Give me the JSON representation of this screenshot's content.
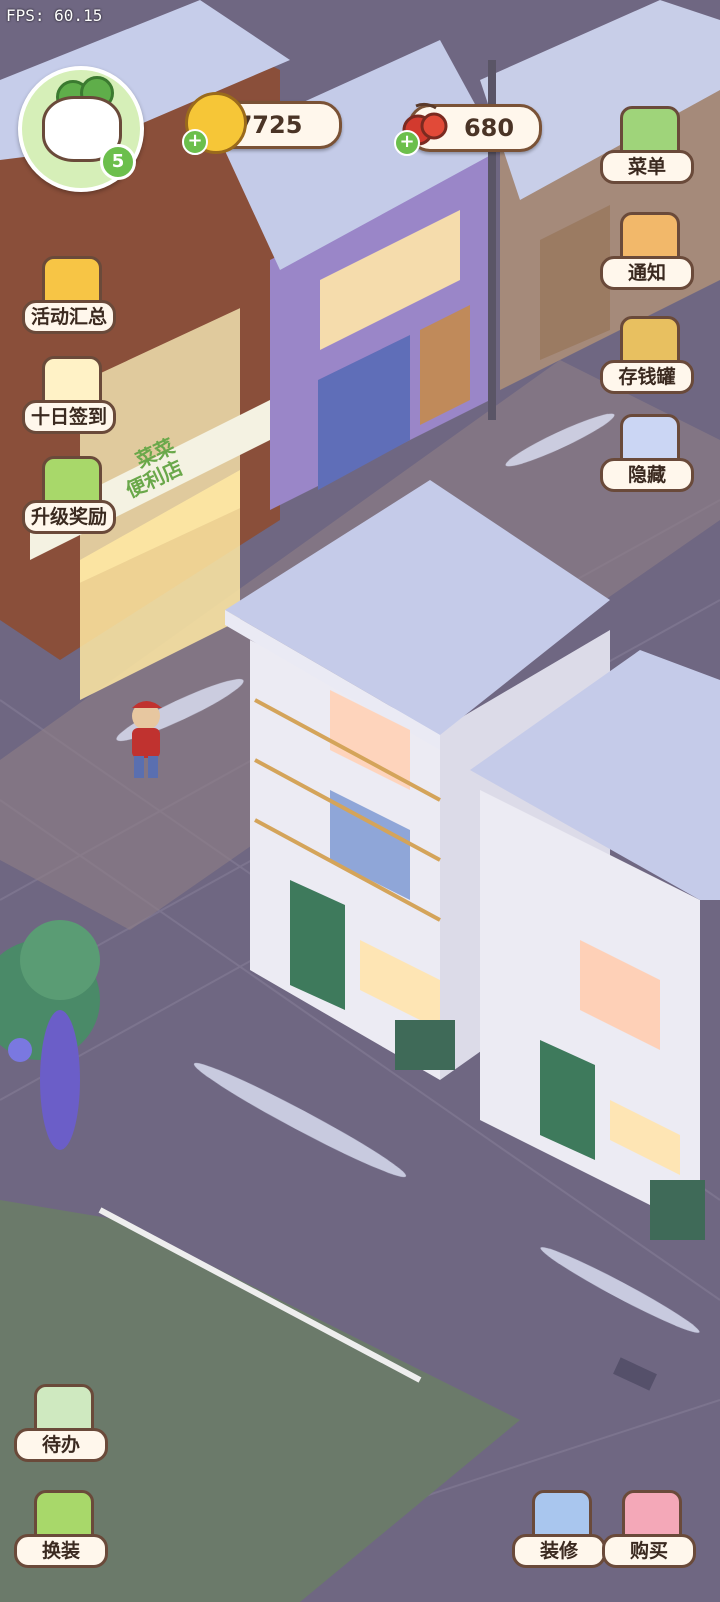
{
  "hud": {
    "fps": "FPS: 60.15",
    "player_level": "5",
    "coins": "7725",
    "cherries": "680",
    "plus_symbol": "+"
  },
  "left_menu": [
    {
      "label": "活动汇总",
      "icon": "crown-icon"
    },
    {
      "label": "十日签到",
      "icon": "calendar-check-icon"
    },
    {
      "label": "升级奖励",
      "icon": "upgrade-arrows-icon"
    }
  ],
  "right_menu": [
    {
      "label": "菜单",
      "icon": "list-menu-icon"
    },
    {
      "label": "通知",
      "icon": "bell-icon"
    },
    {
      "label": "存钱罐",
      "icon": "piggy-bank-icon"
    },
    {
      "label": "隐藏",
      "icon": "hide-frame-icon"
    }
  ],
  "bottom_left": [
    {
      "label": "待办",
      "icon": "todo-checklist-icon"
    },
    {
      "label": "换装",
      "icon": "wardrobe-icon"
    }
  ],
  "bottom_right": [
    {
      "label": "装修",
      "icon": "decorate-icon"
    },
    {
      "label": "购买",
      "icon": "shopping-bag-icon"
    }
  ],
  "scene": {
    "shop_sign_line1": "菜菜",
    "shop_sign_line2": "便利店"
  },
  "colors": {
    "street": "#6e6680",
    "snow_roof": "#bcc4e6",
    "coin": "#f6c637",
    "accent_green": "#6cbf4c"
  }
}
